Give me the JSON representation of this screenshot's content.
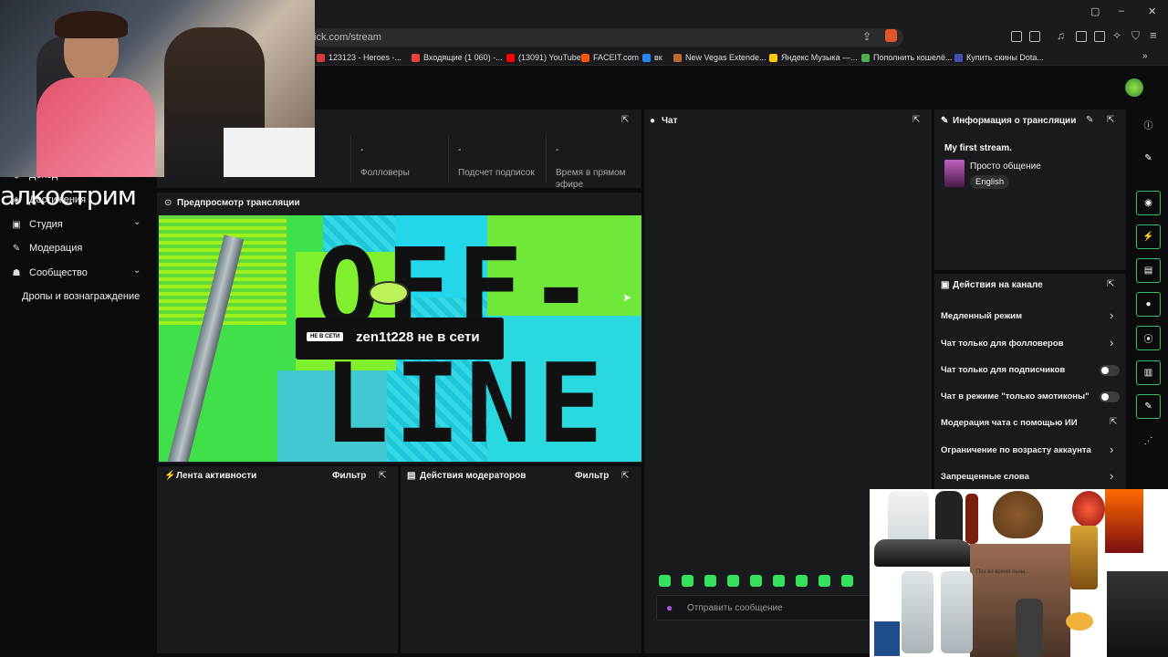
{
  "browser": {
    "url": "ick.com/stream",
    "window_controls": [
      "–",
      "▢",
      "✕"
    ],
    "bookmarks": [
      {
        "label": "123123 - Heroes -...",
        "color": "#d93a3a"
      },
      {
        "label": "Входящие (1 060) -...",
        "color": "#ea4335"
      },
      {
        "label": "(13091) YouTube",
        "color": "#ff0000"
      },
      {
        "label": "FACEIT.com",
        "color": "#ff5500"
      },
      {
        "label": "вк",
        "color": "#2787f5"
      },
      {
        "label": "New Vegas Extende...",
        "color": "#c06a2b"
      },
      {
        "label": "Яндекс Музыка —...",
        "color": "#ffcc00"
      },
      {
        "label": "Пополнить кошелё...",
        "color": "#4caf50"
      },
      {
        "label": "Купить скины Dota...",
        "color": "#3f51b5"
      }
    ],
    "more_bookmarks": "»"
  },
  "overlay": {
    "stream_title_text": "алкострим"
  },
  "sidebar": {
    "items": [
      {
        "label": "Доход",
        "icon": "dollar-icon",
        "glyph": "$"
      },
      {
        "label": "Достижения",
        "icon": "trophy-icon",
        "glyph": "◈"
      },
      {
        "label": "Студия",
        "icon": "video-icon",
        "glyph": "▣",
        "chevron": "⌄"
      },
      {
        "label": "Модерация",
        "icon": "wrench-icon",
        "glyph": "✎"
      },
      {
        "label": "Сообщество",
        "icon": "users-icon",
        "glyph": "☗",
        "chevron": "⌄"
      },
      {
        "label": "Дропы и вознаграждение",
        "icon": "",
        "glyph": ""
      }
    ]
  },
  "stats": [
    {
      "value": "-",
      "label": "Фолловеры"
    },
    {
      "value": "-",
      "label": "Подсчет подписок"
    },
    {
      "value": "-",
      "label": "Время в прямом эфире"
    }
  ],
  "preview": {
    "title": "Предпросмотр трансляции",
    "offline_tag": "НЕ В СЕТИ",
    "offline_text": "zen1t228 не в сети",
    "graphic_text_1": "OFF-",
    "graphic_text_2": "LINE"
  },
  "activity": {
    "title": "Лента активности",
    "filter": "Фильтр"
  },
  "mod_actions": {
    "title": "Действия модераторов",
    "filter": "Фильтр"
  },
  "chat": {
    "title": "Чат",
    "placeholder": "Отправить сообщение"
  },
  "stream_info": {
    "title": "Информация о трансляции",
    "stream_name": "My first stream.",
    "category": "Просто общение",
    "language": "English"
  },
  "channel_actions": {
    "title": "Действия на канале",
    "items": [
      {
        "label": "Медленный режим",
        "control": "chevron"
      },
      {
        "label": "Чат только для фолловеров",
        "control": "chevron"
      },
      {
        "label": "Чат только для подписчиков",
        "control": "toggle",
        "on": false
      },
      {
        "label": "Чат в режиме \"только эмотиконы\"",
        "control": "toggle",
        "on": false
      },
      {
        "label": "Модерация чата с помощью ИИ",
        "control": "external"
      },
      {
        "label": "Ограничение по возрасту аккаунта",
        "control": "chevron"
      },
      {
        "label": "Запрещенные слова",
        "control": "chevron"
      }
    ]
  },
  "meme_overlay": {
    "caption": "Пиз во время пьны..."
  },
  "colors": {
    "accent": "#53fc18",
    "panel": "#191a1d",
    "background": "#0b0b0d"
  }
}
